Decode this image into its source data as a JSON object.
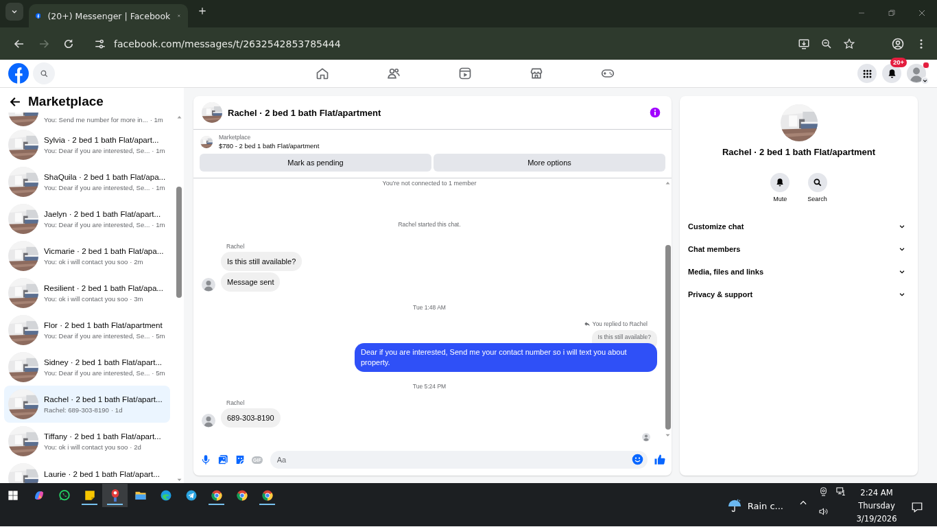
{
  "browser": {
    "tab_title": "(20+) Messenger | Facebook",
    "url": "facebook.com/messages/t/2632542853785444",
    "forward_disabled": true
  },
  "header": {
    "nav": [
      {
        "kind": "home"
      },
      {
        "kind": "friends"
      },
      {
        "kind": "video"
      },
      {
        "kind": "store"
      },
      {
        "kind": "gaming"
      }
    ],
    "notification_badge": "20+"
  },
  "sidebar": {
    "title": "Marketplace",
    "threads": [
      {
        "preview": "You: Send me number for more in...",
        "time": "· 1m",
        "selected": false
      },
      {
        "title": "Sylvia · 2 bed 1 bath Flat/apart...",
        "preview": "You: Dear if you are interested, Se...",
        "time": "· 1m",
        "selected": false
      },
      {
        "title": "ShaQuila · 2 bed 1 bath Flat/apa...",
        "preview": "You: Dear if you are interested, Se...",
        "time": "· 1m",
        "selected": false
      },
      {
        "title": "Jaelyn · 2 bed 1 bath Flat/apart...",
        "preview": "You: Dear if you are interested, Se...",
        "time": "· 1m",
        "selected": false
      },
      {
        "title": "Vicmarie · 2 bed 1 bath Flat/apa...",
        "preview": "You: ok i will contact you soo",
        "time": "· 2m",
        "selected": false
      },
      {
        "title": "Resilient · 2 bed 1 bath Flat/apa...",
        "preview": "You: ok i will contact you soo",
        "time": "· 3m",
        "selected": false
      },
      {
        "title": "Flor · 2 bed 1 bath Flat/apartment",
        "preview": "You: Dear if you are interested, Se...",
        "time": "· 5m",
        "selected": false
      },
      {
        "title": "Sidney · 2 bed 1 bath Flat/apart...",
        "preview": "You: Dear if you are interested, Se...",
        "time": "· 5m",
        "selected": false
      },
      {
        "title": "Rachel · 2 bed 1 bath Flat/apart...",
        "preview": "Rachel: 689-303-8190",
        "time": "· 1d",
        "selected": true
      },
      {
        "title": "Tiffany · 2 bed 1 bath Flat/apart...",
        "preview": "You: ok i will contact you soo",
        "time": "· 2d",
        "selected": false
      },
      {
        "title": "Laurie · 2 bed 1 bath Flat/apart...",
        "selected": false
      }
    ]
  },
  "chat": {
    "title": "Rachel · 2 bed 1 bath Flat/apartment",
    "listing": {
      "label": "Marketplace",
      "text": "$780 - 2 bed 1 bath Flat/apartment"
    },
    "actions": [
      "Mark as pending",
      "More options"
    ],
    "notice": "You're not connected to 1 member",
    "messages": [
      {
        "kind": "system",
        "text": "Rachel started this chat."
      },
      {
        "kind": "sender",
        "text": "Rachel"
      },
      {
        "kind": "incoming",
        "text": "Is this still available?",
        "avatar": false
      },
      {
        "kind": "incoming",
        "text": "Message sent",
        "avatar": true
      },
      {
        "kind": "timestamp",
        "text": "Tue 1:48 AM"
      },
      {
        "kind": "reply_note",
        "text": "You replied to Rachel"
      },
      {
        "kind": "quote",
        "text": "Is this still available?"
      },
      {
        "kind": "outgoing",
        "text": "Dear if you are interested, Send me your contact number so i will text you about property."
      },
      {
        "kind": "timestamp",
        "text": "Tue 5:24 PM"
      },
      {
        "kind": "sender",
        "text": "Rachel"
      },
      {
        "kind": "incoming",
        "text": "689-303-8190",
        "avatar": true
      },
      {
        "kind": "seen"
      }
    ],
    "composer": {
      "gif": "GIF",
      "placeholder": "Aa"
    }
  },
  "info": {
    "title": "Rachel · 2 bed 1 bath Flat/apartment",
    "actions": [
      {
        "kind": "mute",
        "label": "Mute"
      },
      {
        "kind": "search",
        "label": "Search"
      }
    ],
    "sections": [
      {
        "label": "Customize chat",
        "expanded": false
      },
      {
        "label": "Chat members",
        "expanded": false
      },
      {
        "label": "Media, files and links",
        "expanded": false
      },
      {
        "label": "Privacy & support",
        "expanded": false
      }
    ]
  },
  "taskbar": {
    "apps": [
      {
        "kind": "copilot",
        "running": false,
        "selected": false
      },
      {
        "kind": "whatsapp",
        "running": false,
        "selected": false
      },
      {
        "kind": "notes",
        "running": true,
        "selected": false
      },
      {
        "kind": "pin",
        "running": true,
        "selected": true
      },
      {
        "kind": "folder",
        "running": false,
        "selected": false
      },
      {
        "kind": "edge",
        "running": false,
        "selected": false
      },
      {
        "kind": "telegram",
        "running": false,
        "selected": false
      },
      {
        "kind": "chrome",
        "running": true,
        "selected": false
      },
      {
        "kind": "chrome",
        "running": false,
        "selected": false
      },
      {
        "kind": "chrome",
        "running": true,
        "selected": false
      }
    ],
    "weather": "Rain c...",
    "time": "2:24 AM",
    "day": "Thursday",
    "date": "3/19/2026"
  }
}
